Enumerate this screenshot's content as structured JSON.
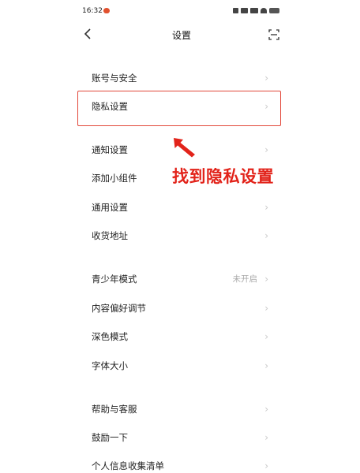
{
  "statusbar": {
    "time": "16:32"
  },
  "navbar": {
    "title": "设置"
  },
  "groups": [
    {
      "items": [
        {
          "label": "账号与安全"
        },
        {
          "label": "隐私设置"
        }
      ]
    },
    {
      "items": [
        {
          "label": "通知设置"
        },
        {
          "label": "添加小组件"
        },
        {
          "label": "通用设置"
        },
        {
          "label": "收货地址"
        }
      ]
    },
    {
      "items": [
        {
          "label": "青少年模式",
          "value": "未开启"
        },
        {
          "label": "内容偏好调节"
        },
        {
          "label": "深色模式"
        },
        {
          "label": "字体大小"
        }
      ]
    },
    {
      "items": [
        {
          "label": "帮助与客服"
        },
        {
          "label": "鼓励一下"
        },
        {
          "label": "个人信息收集清单"
        }
      ]
    }
  ],
  "annotation": {
    "text": "找到隐私设置",
    "color": "#e2231a"
  },
  "highlight": {
    "target": "隐私设置",
    "color": "#e2483b"
  }
}
